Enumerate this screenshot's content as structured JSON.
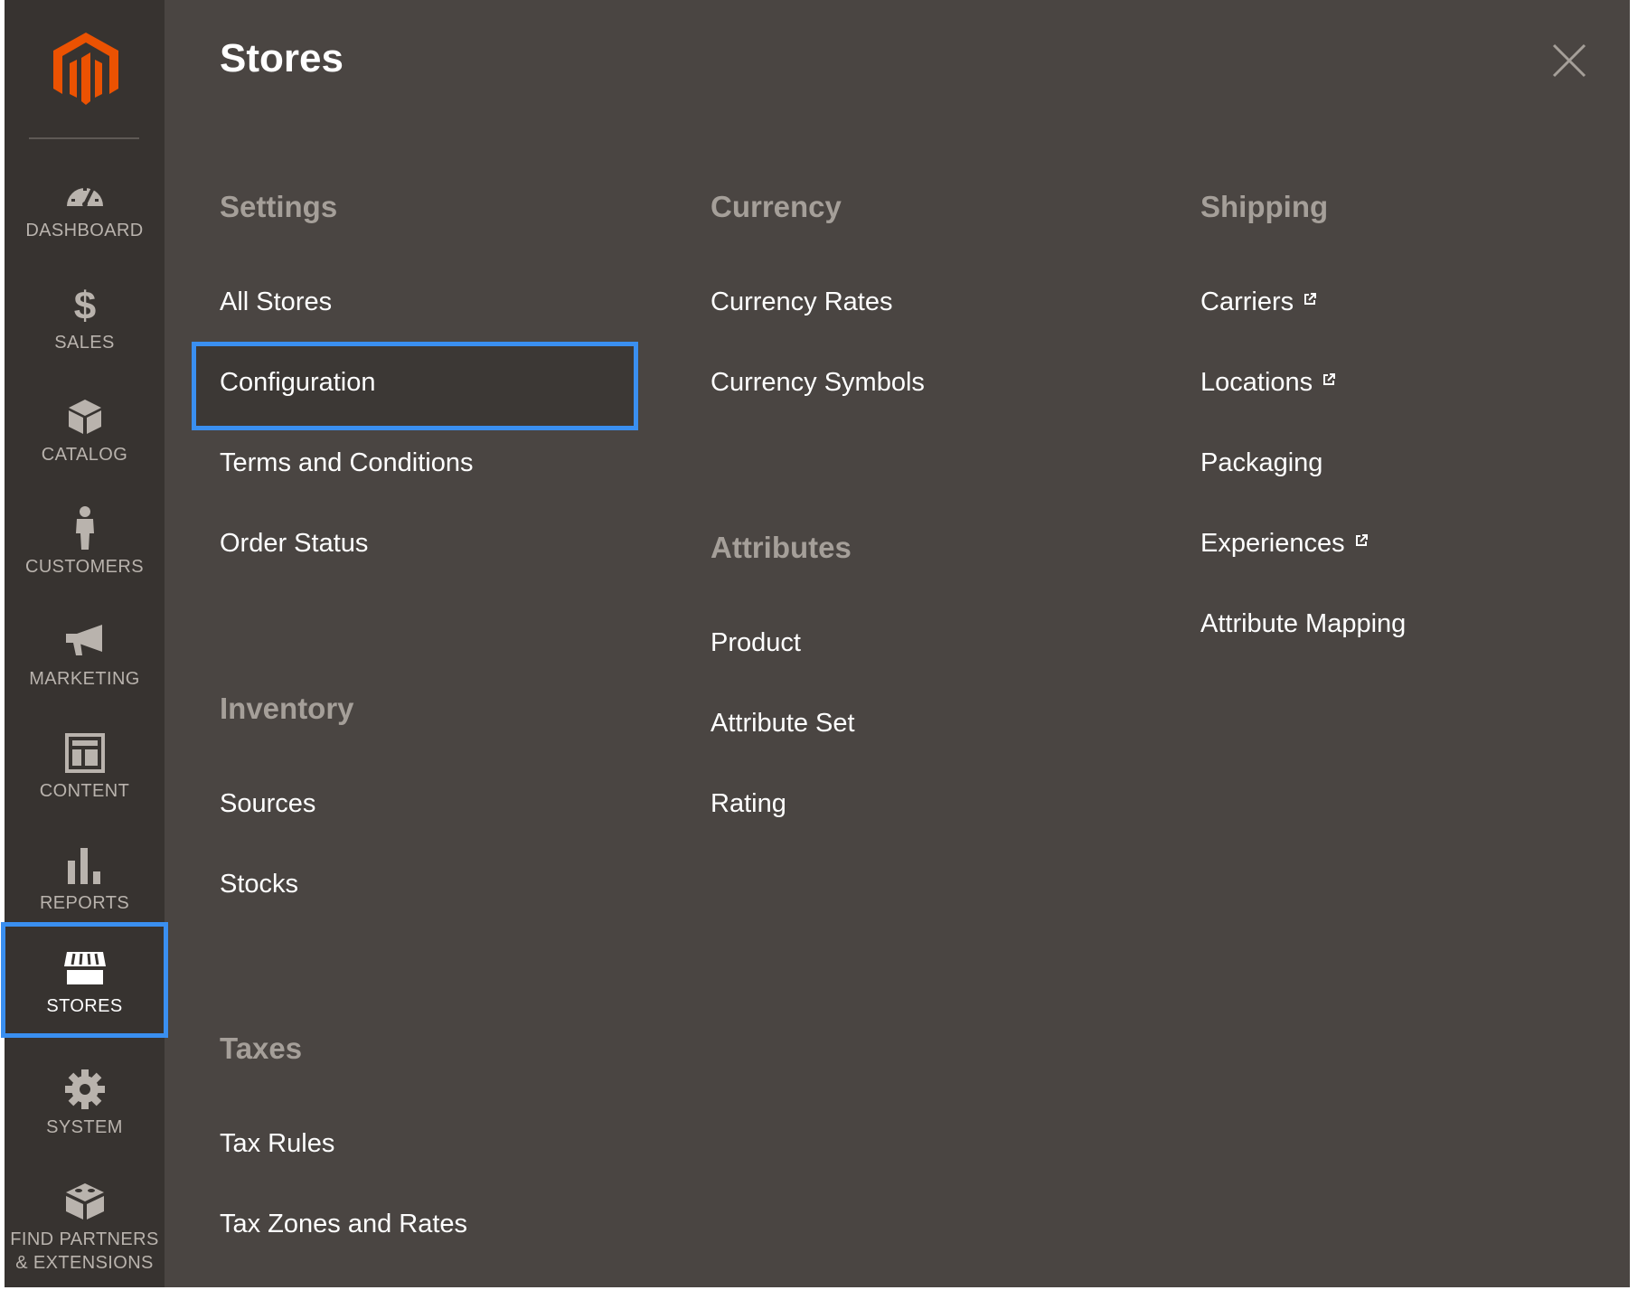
{
  "sidebar": {
    "items": [
      {
        "label": "DASHBOARD",
        "icon": "dashboard-icon"
      },
      {
        "label": "SALES",
        "icon": "dollar-icon"
      },
      {
        "label": "CATALOG",
        "icon": "box-icon"
      },
      {
        "label": "CUSTOMERS",
        "icon": "person-icon"
      },
      {
        "label": "MARKETING",
        "icon": "megaphone-icon"
      },
      {
        "label": "CONTENT",
        "icon": "layout-icon"
      },
      {
        "label": "REPORTS",
        "icon": "bar-chart-icon"
      },
      {
        "label": "STORES",
        "icon": "storefront-icon",
        "active": true
      },
      {
        "label": "SYSTEM",
        "icon": "gear-icon"
      },
      {
        "label": "FIND PARTNERS & EXTENSIONS",
        "icon": "blocks-icon"
      }
    ]
  },
  "panel": {
    "title": "Stores",
    "settings": {
      "title": "Settings",
      "links": [
        "All Stores",
        "Configuration",
        "Terms and Conditions",
        "Order Status"
      ]
    },
    "inventory": {
      "title": "Inventory",
      "links": [
        "Sources",
        "Stocks"
      ]
    },
    "taxes": {
      "title": "Taxes",
      "links": [
        "Tax Rules",
        "Tax Zones and Rates"
      ]
    },
    "currency": {
      "title": "Currency",
      "links": [
        "Currency Rates",
        "Currency Symbols"
      ]
    },
    "attributes": {
      "title": "Attributes",
      "links": [
        "Product",
        "Attribute Set",
        "Rating"
      ]
    },
    "shipping": {
      "title": "Shipping",
      "links": [
        "Carriers",
        "Locations",
        "Packaging",
        "Experiences",
        "Attribute Mapping"
      ]
    }
  },
  "colors": {
    "sidebar_bg": "#373330",
    "panel_bg": "#4a4542",
    "highlight": "#3a8ff0",
    "logo": "#eb5202"
  }
}
